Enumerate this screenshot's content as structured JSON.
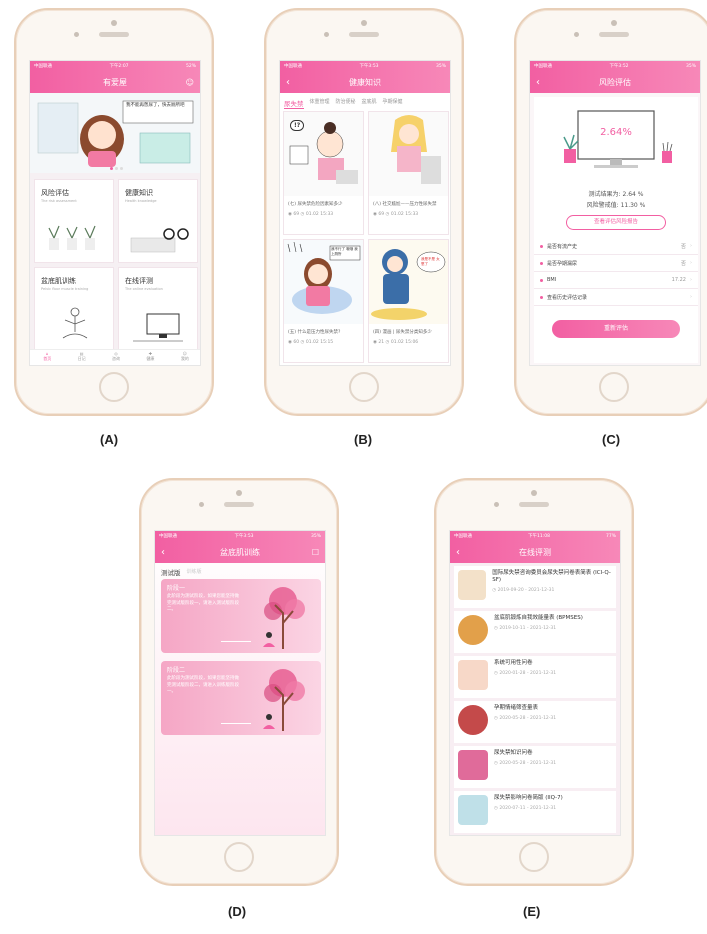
{
  "labels": {
    "a": "(A)",
    "b": "(B)",
    "c": "(C)",
    "d": "(D)",
    "e": "(E)"
  },
  "status": {
    "carrier": "中国联通",
    "time_a": "下午2:07",
    "time_b": "下午3:53",
    "time_c": "下午3:52",
    "time_d": "下午3:53",
    "time_e": "下午11:08",
    "battery_a": "52%",
    "battery_b": "35%",
    "battery_c": "35%",
    "battery_d": "35%",
    "battery_e": "77%"
  },
  "colors": {
    "primary": "#f25fa2",
    "secondary": "#f788b8",
    "bg": "#ffffff"
  },
  "screenA": {
    "title": "有爱屋",
    "tiles": [
      {
        "title": "风险评估",
        "sub": "The risk assessment"
      },
      {
        "title": "健康知识",
        "sub": "Health knowledge"
      },
      {
        "title": "盆底肌训练",
        "sub": "Pelvic floor muscle training"
      },
      {
        "title": "在线评测",
        "sub": "The online evaluation"
      }
    ],
    "banner_text": "我不能再憋尿了，快去厕所吧",
    "tabs": [
      "首页",
      "日记",
      "咨询",
      "健康",
      "我的"
    ]
  },
  "screenB": {
    "title": "健康知识",
    "tabs": [
      "尿失禁",
      "体重管理",
      "防治便秘",
      "盆底肌",
      "孕期保健"
    ],
    "articles": [
      {
        "title": "(七) 尿失禁危险因素知多少",
        "views": "69",
        "date": "01.02 15:33"
      },
      {
        "title": "(八) 社交尴尬——压力性尿失禁",
        "views": "69",
        "date": "01.02 15:33"
      },
      {
        "title": "(五) 什么是压力性尿失禁?",
        "views": "60",
        "date": "01.02 15:15"
      },
      {
        "title": "(四) 漫画 | 尿失禁分类知多少",
        "views": "21",
        "date": "01.02 15:06"
      }
    ],
    "bubble1": "!?",
    "bubble2": "我不行了 哦哦 我上厕所",
    "bubble3": "我是不是 太憋了"
  },
  "screenC": {
    "title": "风险评估",
    "score": "2.64%",
    "result_label": "测试结果为: 2.64 %",
    "warning_label": "风险警戒值: 11.30 %",
    "report_btn": "查看评估风险报告",
    "rows": [
      {
        "label": "是否有流产史",
        "value": "否"
      },
      {
        "label": "是否孕期漏尿",
        "value": "否"
      },
      {
        "label": "BMI",
        "value": "17.22"
      },
      {
        "label": "查看历史评估记录",
        "value": ""
      }
    ],
    "reassess_btn": "重新评估"
  },
  "screenD": {
    "title": "盆底肌训练",
    "tabs": [
      "测试版",
      "训练版"
    ],
    "stages": [
      {
        "title": "阶段一",
        "text": "此阶段为测试阶段，如果您能坚持做完测试版阶段一，请进入测试版阶段二。"
      },
      {
        "title": "阶段二",
        "text": "此阶段为测试阶段，如果您能坚持做完测试版阶段二，请进入训练版阶段一。"
      }
    ]
  },
  "screenE": {
    "title": "在线评测",
    "items": [
      {
        "title": "国际尿失禁咨询委员会尿失禁问卷表简表 (ICI-Q-SF)",
        "date": "2019-09-20 - 2021-12-31"
      },
      {
        "title": "盆底肌锻炼自我效能量表 (BPMSES)",
        "date": "2019-10-11 - 2021-12-31"
      },
      {
        "title": "系统可用性问卷",
        "date": "2020-01-28 - 2021-12-31"
      },
      {
        "title": "孕期情绪筛查量表",
        "date": "2020-05-28 - 2021-12-31"
      },
      {
        "title": "尿失禁知识问卷",
        "date": "2020-05-28 - 2021-12-31"
      },
      {
        "title": "尿失禁影响问卷简版 (IIQ-7)",
        "date": "2020-07-11 - 2021-12-31"
      }
    ]
  }
}
